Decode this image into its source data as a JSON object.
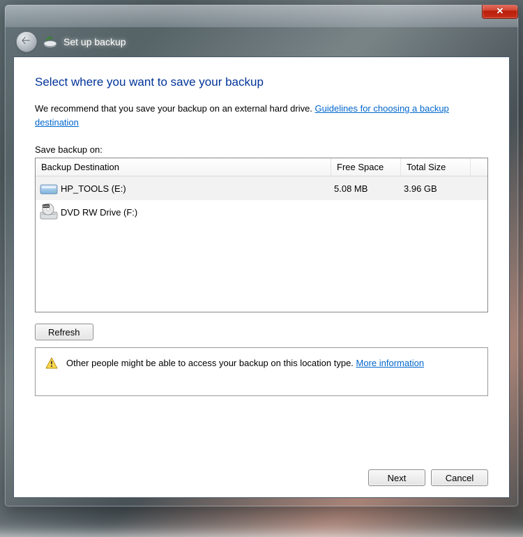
{
  "header": {
    "title": "Set up backup"
  },
  "wizard": {
    "heading": "Select where you want to save your backup",
    "recommend_prefix": "We recommend that you save your backup on an external hard drive. ",
    "guidelines_link": "Guidelines for choosing a backup destination",
    "list_label": "Save backup on:",
    "columns": {
      "destination": "Backup Destination",
      "free_space": "Free Space",
      "total_size": "Total Size"
    },
    "drives": [
      {
        "name": "HP_TOOLS (E:)",
        "free": "5.08 MB",
        "total": "3.96 GB",
        "icon": "hdd",
        "selected": true
      },
      {
        "name": "DVD RW Drive (F:)",
        "free": "",
        "total": "",
        "icon": "dvd",
        "selected": false
      }
    ],
    "refresh_label": "Refresh",
    "warning_text": "Other people might be able to access your backup on this location type. ",
    "more_info_link": "More information"
  },
  "footer": {
    "next_label": "Next",
    "cancel_label": "Cancel"
  }
}
